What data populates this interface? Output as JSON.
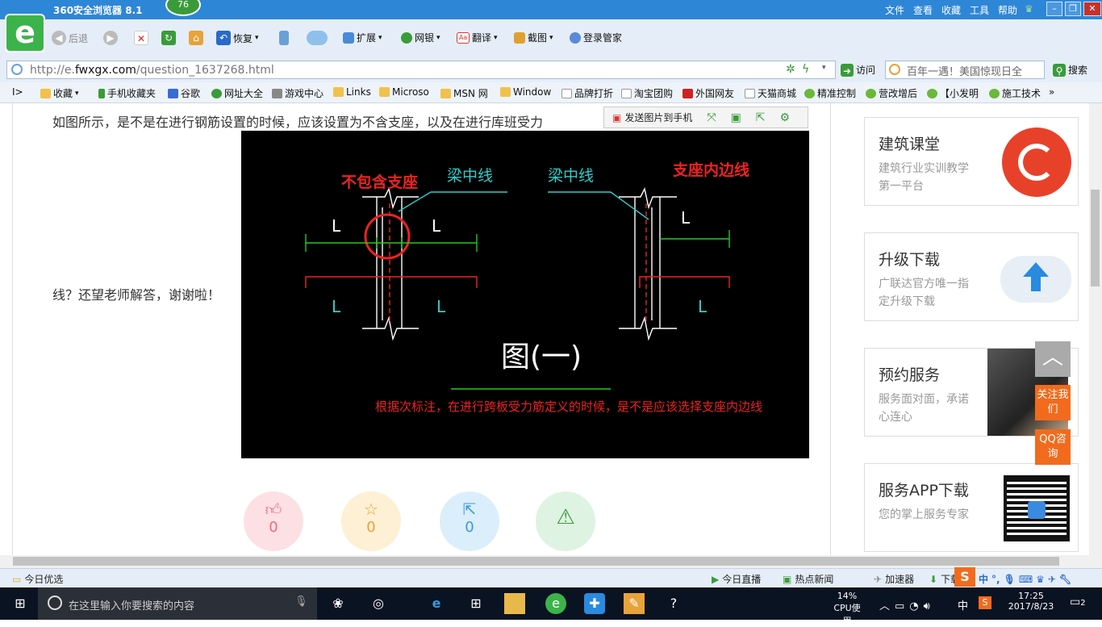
{
  "browser": {
    "title": "360安全浏览器 8.1",
    "badge": "76",
    "menus": [
      "文件",
      "查看",
      "收藏",
      "工具",
      "帮助"
    ],
    "logo_letter": "e"
  },
  "toolbar": {
    "back": "后退",
    "restore": "恢复",
    "extend": "扩展",
    "bank": "网银",
    "translate": "翻译",
    "screenshot": "截图",
    "login": "登录管家"
  },
  "address": {
    "prefix": "http://e.",
    "domain": "fwxgx.com",
    "path": "/question_1637268.html",
    "visit": "访问",
    "search_text": "百年一遇！美国惊现日全",
    "search_btn": "搜索"
  },
  "favorites": [
    "收藏",
    "手机收藏夹",
    "谷歌",
    "网址大全",
    "游戏中心",
    "Links",
    "Microso",
    "MSN 网",
    "Window",
    "品牌打折",
    "淘宝团购",
    "外国网友",
    "天猫商城",
    "精准控制",
    "营改增后",
    "【小发明",
    "施工技术"
  ],
  "question": {
    "line1": "如图所示，是不是在进行钢筋设置的时候，应该设置为不含支座，以及在进行库班受力",
    "line2": "线？还望老师解答，谢谢啦！"
  },
  "image_toolbar": {
    "send": "发送图片到手机"
  },
  "cad": {
    "label_left": "不包含支座",
    "label_center1": "梁中线",
    "label_center2": "梁中线",
    "label_right": "支座内边线",
    "L": "L",
    "figure": "图(一)",
    "note": "根据次标注，在进行跨板受力筋定义的时候，是不是应该选择支座内边线"
  },
  "actions": [
    {
      "icon": "thumbs-up",
      "count": "0"
    },
    {
      "icon": "star",
      "count": "0"
    },
    {
      "icon": "share",
      "count": "0"
    },
    {
      "icon": "warning",
      "count": ""
    }
  ],
  "sidebar": [
    {
      "title": "建筑课堂",
      "desc": "建筑行业实训教学第一平台"
    },
    {
      "title": "升级下载",
      "desc": "广联达官方唯一指定升级下载"
    },
    {
      "title": "预约服务",
      "desc": "服务面对面，承诺心连心"
    },
    {
      "title": "服务APP下载",
      "desc": "您的掌上服务专家"
    }
  ],
  "float": {
    "follow": "关注我们",
    "qq": "QQ咨询"
  },
  "status": {
    "today": "今日优选",
    "live": "今日直播",
    "hot": "热点新闻",
    "speed": "加速器",
    "down": "下载"
  },
  "taskbar": {
    "search": "在这里输入你要搜索的内容",
    "cpu_pct": "14%",
    "cpu": "CPU使用",
    "time": "17:25",
    "date": "2017/8/23",
    "lang": "中",
    "notif": "2"
  },
  "colors": {
    "accent": "#2e86d6",
    "green": "#3cb34a",
    "orange": "#f26b1d"
  }
}
